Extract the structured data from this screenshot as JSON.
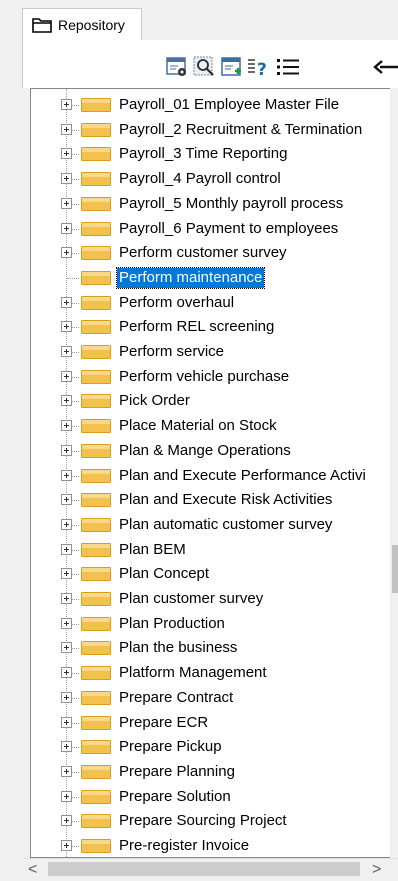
{
  "tab": {
    "label": "Repository"
  },
  "toolbar": {
    "buttons": [
      {
        "name": "properties-icon"
      },
      {
        "name": "search-icon"
      },
      {
        "name": "new-item-icon"
      },
      {
        "name": "help-list-icon"
      },
      {
        "name": "list-view-icon"
      },
      {
        "name": "arrow-icon"
      }
    ]
  },
  "tree": {
    "items": [
      {
        "label": "Payroll_01 Employee Master File",
        "expandable": true,
        "selected": false
      },
      {
        "label": "Payroll_2 Recruitment & Termination",
        "expandable": true,
        "selected": false
      },
      {
        "label": "Payroll_3 Time Reporting",
        "expandable": true,
        "selected": false
      },
      {
        "label": "Payroll_4 Payroll control",
        "expandable": true,
        "selected": false
      },
      {
        "label": "Payroll_5 Monthly payroll process",
        "expandable": true,
        "selected": false
      },
      {
        "label": "Payroll_6 Payment to employees",
        "expandable": true,
        "selected": false
      },
      {
        "label": "Perform customer survey",
        "expandable": true,
        "selected": false
      },
      {
        "label": "Perform maintenance",
        "expandable": false,
        "selected": true
      },
      {
        "label": "Perform overhaul",
        "expandable": true,
        "selected": false
      },
      {
        "label": "Perform REL screening",
        "expandable": true,
        "selected": false
      },
      {
        "label": "Perform service",
        "expandable": true,
        "selected": false
      },
      {
        "label": "Perform vehicle purchase",
        "expandable": true,
        "selected": false
      },
      {
        "label": "Pick Order",
        "expandable": true,
        "selected": false
      },
      {
        "label": "Place Material on Stock",
        "expandable": true,
        "selected": false
      },
      {
        "label": "Plan & Mange Operations",
        "expandable": true,
        "selected": false
      },
      {
        "label": "Plan and Execute Performance Activi",
        "expandable": true,
        "selected": false
      },
      {
        "label": "Plan and Execute Risk Activities",
        "expandable": true,
        "selected": false
      },
      {
        "label": "Plan automatic customer survey",
        "expandable": true,
        "selected": false
      },
      {
        "label": "Plan BEM",
        "expandable": true,
        "selected": false
      },
      {
        "label": "Plan Concept",
        "expandable": true,
        "selected": false
      },
      {
        "label": "Plan customer survey",
        "expandable": true,
        "selected": false
      },
      {
        "label": "Plan Production",
        "expandable": true,
        "selected": false
      },
      {
        "label": "Plan the business",
        "expandable": true,
        "selected": false
      },
      {
        "label": "Platform Management",
        "expandable": true,
        "selected": false
      },
      {
        "label": "Prepare Contract",
        "expandable": true,
        "selected": false
      },
      {
        "label": "Prepare ECR",
        "expandable": true,
        "selected": false
      },
      {
        "label": "Prepare Pickup",
        "expandable": true,
        "selected": false
      },
      {
        "label": "Prepare Planning",
        "expandable": true,
        "selected": false
      },
      {
        "label": "Prepare Solution",
        "expandable": true,
        "selected": false
      },
      {
        "label": "Prepare Sourcing Project",
        "expandable": true,
        "selected": false
      },
      {
        "label": "Pre-register Invoice",
        "expandable": true,
        "selected": false
      }
    ]
  },
  "scrollbar": {
    "left_arrow": "<",
    "right_arrow": ">"
  }
}
